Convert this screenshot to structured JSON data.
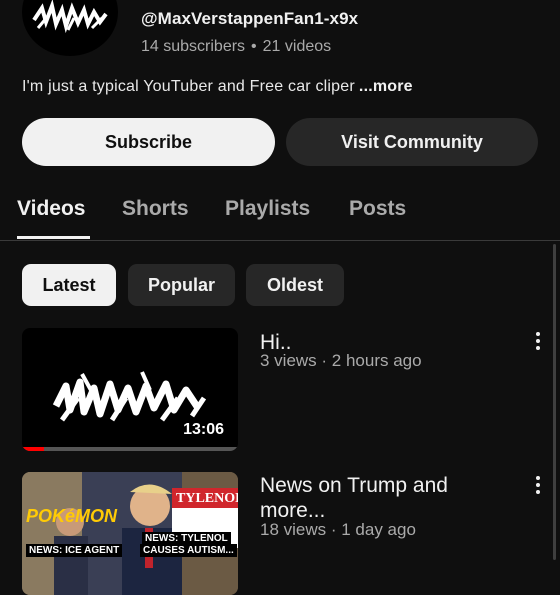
{
  "channel": {
    "handle": "@MaxVerstappenFan1-x9x",
    "subscribers": "14 subscribers",
    "videos_count": "21 videos",
    "separator": "•",
    "description": "I'm just a typical YouTuber and Free car cliper",
    "more_label": "...more"
  },
  "actions": {
    "subscribe_label": "Subscribe",
    "community_label": "Visit Community"
  },
  "tabs": [
    {
      "label": "Videos",
      "active": true
    },
    {
      "label": "Shorts",
      "active": false
    },
    {
      "label": "Playlists",
      "active": false
    },
    {
      "label": "Posts",
      "active": false
    }
  ],
  "chips": [
    {
      "label": "Latest",
      "active": true
    },
    {
      "label": "Popular",
      "active": false
    },
    {
      "label": "Oldest",
      "active": false
    }
  ],
  "videos": [
    {
      "title": "Hi..",
      "meta": "3 views · 2 hours ago",
      "duration": "13:06",
      "watch_progress": 0.1
    },
    {
      "title": "News on Trump and more...",
      "meta": "18 views · 1 day ago",
      "thumb_texts": {
        "brand": "TYLENOL",
        "pokemon": "POKéMON",
        "caption_left": "NEWS: ICE AGENT",
        "caption_right_1": "NEWS: TYLENOL",
        "caption_right_2": "CAUSES AUTISM..."
      }
    }
  ],
  "colors": {
    "background": "#0f0f0f",
    "accent_red": "#ff0000",
    "chip_bg": "#272727"
  }
}
